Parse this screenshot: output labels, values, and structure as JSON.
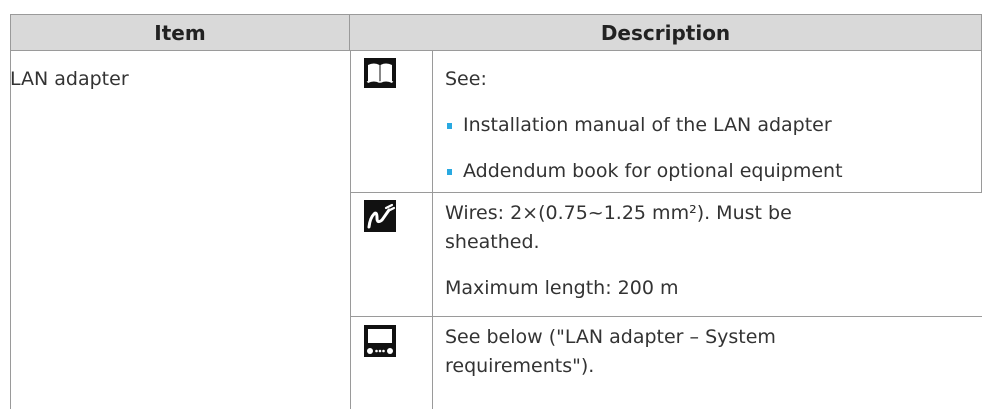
{
  "table": {
    "headers": {
      "item": "Item",
      "description": "Description"
    },
    "row": {
      "item": "LAN adapter",
      "blocks": [
        {
          "icon": "manual-book-icon",
          "see_label": "See:",
          "bullets": [
            "Installation manual of the LAN adapter",
            "Addendum book for optional equipment"
          ]
        },
        {
          "icon": "wire-connection-icon",
          "wires_line1": "Wires: 2×(0.75~1.25 mm²). Must be",
          "wires_line2": "sheathed.",
          "max_length": "Maximum length: 200 m"
        },
        {
          "icon": "lan-adapter-device-icon",
          "line1": "See below (\"LAN adapter – System",
          "line2": "requirements\")."
        }
      ]
    }
  },
  "colors": {
    "bullet": "#29a9e1",
    "header_bg": "#d9d9d9",
    "border": "#9a9a9a"
  }
}
